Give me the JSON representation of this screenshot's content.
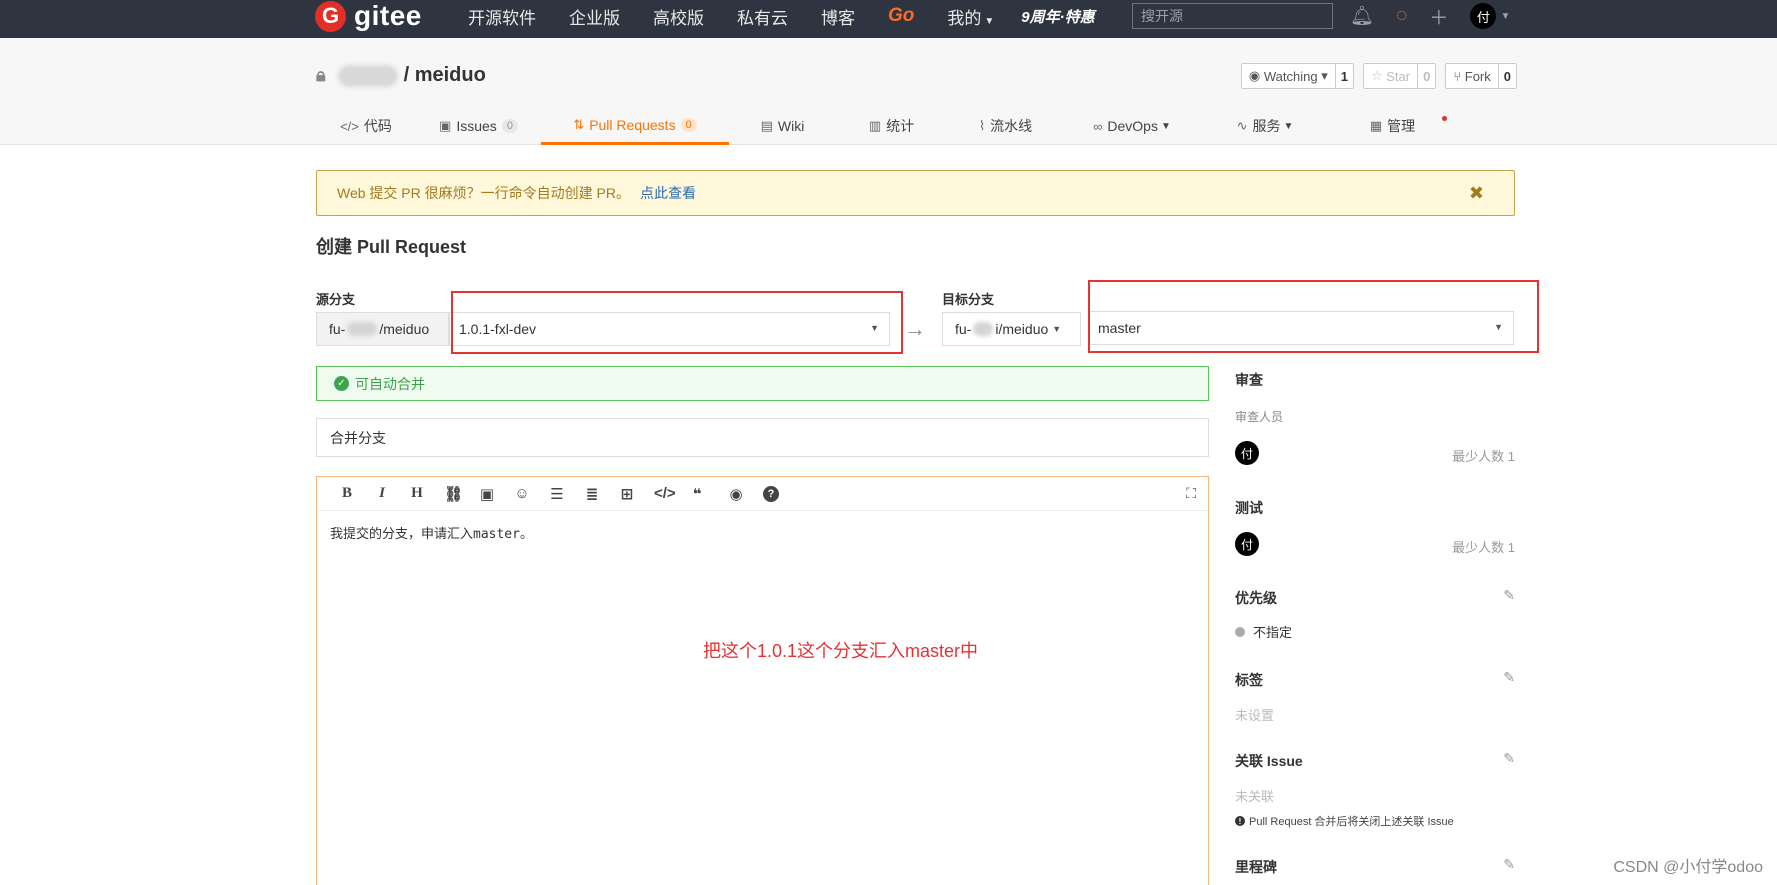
{
  "nav": {
    "logo_text": "gitee",
    "items": [
      "开源软件",
      "企业版",
      "高校版",
      "私有云",
      "博客"
    ],
    "go": "Go",
    "mine": "我的",
    "anniversary": "9周年·特惠",
    "search_placeholder": "搜开源",
    "avatar": "付"
  },
  "repo": {
    "separator": "/",
    "name": "meiduo",
    "watch_label": "Watching",
    "watch_count": "1",
    "star_label": "Star",
    "star_count": "0",
    "fork_label": "Fork",
    "fork_count": "0"
  },
  "tabs": [
    {
      "label": "代码",
      "count": ""
    },
    {
      "label": "Issues",
      "count": "0"
    },
    {
      "label": "Pull Requests",
      "count": "0"
    },
    {
      "label": "Wiki",
      "count": ""
    },
    {
      "label": "统计",
      "count": ""
    },
    {
      "label": "流水线",
      "count": ""
    },
    {
      "label": "DevOps",
      "count": ""
    },
    {
      "label": "服务",
      "count": ""
    },
    {
      "label": "管理",
      "count": ""
    }
  ],
  "banner": {
    "text": "Web 提交 PR 很麻烦？一行命令自动创建 PR。",
    "link": "点此查看"
  },
  "page_title": "创建 Pull Request",
  "source": {
    "label": "源分支",
    "repo_prefix": "fu-",
    "repo_suffix": "/meiduo",
    "branch": "1.0.1-fxl-dev"
  },
  "target": {
    "label": "目标分支",
    "repo_prefix": "fu-",
    "repo_suffix": "i/meiduo",
    "branch": "master"
  },
  "merge_status": "可自动合并",
  "pr_title": "合并分支",
  "pr_body": "我提交的分支，申请汇入master。",
  "annotation": "把这个1.0.1这个分支汇入master中",
  "sidebar": {
    "review_title": "审查",
    "reviewers_label": "审查人员",
    "reviewer_avatar": "付",
    "reviewer_min": "最少人数 1",
    "test_title": "测试",
    "tester_avatar": "付",
    "tester_min": "最少人数 1",
    "priority_title": "优先级",
    "priority_value": "不指定",
    "labels_title": "标签",
    "labels_value": "未设置",
    "issue_title": "关联 Issue",
    "issue_value": "未关联",
    "issue_note": "Pull Request 合并后将关闭上述关联 Issue",
    "milestone_title": "里程碑"
  },
  "watermark": "CSDN @小付学odoo"
}
